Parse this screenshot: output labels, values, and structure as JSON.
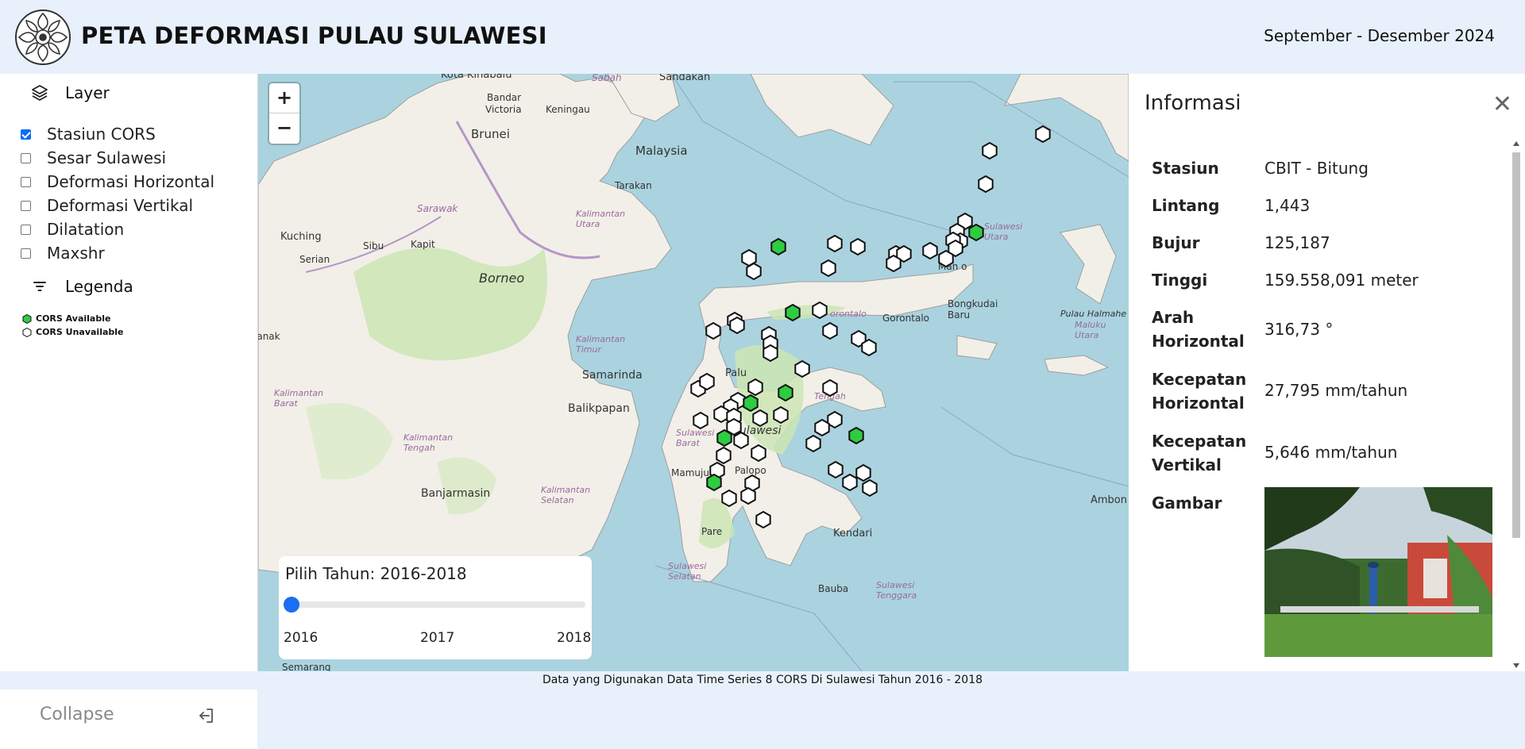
{
  "header": {
    "title": "PETA DEFORMASI PULAU SULAWESI",
    "period": "September - Desember 2024"
  },
  "sidebar": {
    "layer_heading": "Layer",
    "layers": [
      {
        "label": "Stasiun CORS",
        "checked": true
      },
      {
        "label": "Sesar Sulawesi",
        "checked": false
      },
      {
        "label": "Deformasi Horizontal",
        "checked": false
      },
      {
        "label": "Deformasi Vertikal",
        "checked": false
      },
      {
        "label": "Dilatation",
        "checked": false
      },
      {
        "label": "Maxshr",
        "checked": false
      }
    ],
    "legend_heading": "Legenda",
    "legend": [
      {
        "label": "CORS Available",
        "color": "#2ecc40"
      },
      {
        "label": "CORS Unavailable",
        "color": "#ffffff"
      }
    ],
    "collapse_label": "Collapse"
  },
  "map": {
    "zoom_in": "+",
    "zoom_out": "−",
    "place_labels": {
      "kota_kinabalu": "Kota Kinabalu",
      "sabah": "Sabah",
      "sandakan": "Sandakan",
      "bandar": "Bandar",
      "victoria": "Victoria",
      "keningau": "Keningau",
      "brunei": "Brunei",
      "malaysia": "Malaysia",
      "tarakan": "Tarakan",
      "sarawak": "Sarawak",
      "kalimantan_utara": "Kalimantan Utara",
      "kuching": "Kuching",
      "sibu": "Sibu",
      "kapit": "Kapit",
      "borneo": "Borneo",
      "serian": "Serian",
      "anak": "ianak",
      "kalimantan_timur": "Kalimantan Timur",
      "samarinda": "Samarinda",
      "kalimantan_barat": "Kalimantan Barat",
      "balikpapan": "Balikpapan",
      "kalimantan_tengah": "Kalimantan Tengah",
      "banjarmasin": "Banjarmasin",
      "kalimantan_selatan": "Kalimantan Selatan",
      "semarang": "Semarang",
      "palu": "Palu",
      "sulawesi": "Sulawesi",
      "sulawesi_tengah": "Tengah",
      "sulawesi_barat": "Sulawesi Barat",
      "mamuju": "Mamuju",
      "palopo": "Palopo",
      "parepare": "Pare",
      "sulawesi_selatan": "Sulawesi Selatan",
      "kendari": "Kendari",
      "baubau": "Bauba",
      "sulawesi_tenggara": "Sulawesi Tenggara",
      "gorontalo": "Gorontalo",
      "gorontalo_prov": "orontalo",
      "manado": "Man o",
      "bongkudai": "Bongkudai",
      "baru": "Baru",
      "sulawesi_utara": "Sulawesi Utara",
      "pulau_halmahera": "Pulau Halmahe",
      "maluku_utara": "Maluku Utara",
      "ambon": "Ambon"
    }
  },
  "year_slider": {
    "label": "Pilih Tahun: 2016-2018",
    "value": 2016,
    "min": 2016,
    "max": 2018,
    "ticks": [
      "2016",
      "2017",
      "2018"
    ]
  },
  "info": {
    "title": "Informasi",
    "close": "✕",
    "rows": [
      {
        "label": "Stasiun",
        "value": "CBIT - Bitung"
      },
      {
        "label": "Lintang",
        "value": "1,443"
      },
      {
        "label": "Bujur",
        "value": "125,187"
      },
      {
        "label": "Tinggi",
        "value": "159.558,091 meter"
      },
      {
        "label": "Arah Horizontal",
        "value": "316,73 °"
      },
      {
        "label": "Kecepatan Horizontal",
        "value": "27,795 mm/tahun"
      },
      {
        "label": "Kecepatan Vertikal",
        "value": "5,646 mm/tahun"
      },
      {
        "label": "Gambar",
        "value": ""
      }
    ]
  },
  "footer": "Data yang Digunakan Data Time Series 8 CORS Di Sulawesi Tahun 2016 - 2018"
}
